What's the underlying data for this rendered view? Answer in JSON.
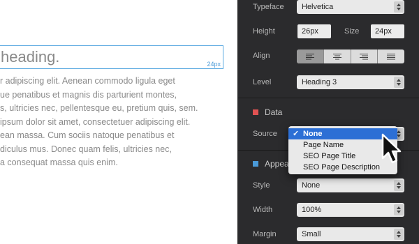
{
  "canvas": {
    "heading": "heading.",
    "heading_size": "24px",
    "body_lines": [
      "r adipiscing elit. Aenean commodo ligula eget",
      "ue penatibus et magnis dis parturient montes,",
      "s, ultricies nec, pellentesque eu, pretium quis, sem.",
      " ipsum dolor sit amet, consectetuer adipiscing elit.",
      "ean massa. Cum sociis natoque penatibus et",
      "diculus mus. Donec quam felis, ultricies nec,",
      "a consequat massa quis enim."
    ]
  },
  "panel": {
    "typeface": {
      "label": "Typeface",
      "value": "Helvetica"
    },
    "height": {
      "label": "Height",
      "value": "26px"
    },
    "size": {
      "label": "Size",
      "value": "24px"
    },
    "align": {
      "label": "Align",
      "options": [
        "left",
        "center",
        "right",
        "justify"
      ],
      "selected": "left"
    },
    "level": {
      "label": "Level",
      "value": "Heading 3"
    },
    "data_section": {
      "title": "Data",
      "color": "#e05252"
    },
    "source": {
      "label": "Source"
    },
    "appearance_section": {
      "title": "Appea",
      "color": "#4a9ad8"
    },
    "style": {
      "label": "Style",
      "value": "None"
    },
    "width": {
      "label": "Width",
      "value": "100%"
    },
    "margin": {
      "label": "Margin",
      "value": "Small"
    }
  },
  "source_dropdown": {
    "check": "✓",
    "options": [
      "None",
      "Page Name",
      "SEO Page Title",
      "SEO Page Description"
    ],
    "selected": "None",
    "highlight_color": "#2c6fd5"
  }
}
